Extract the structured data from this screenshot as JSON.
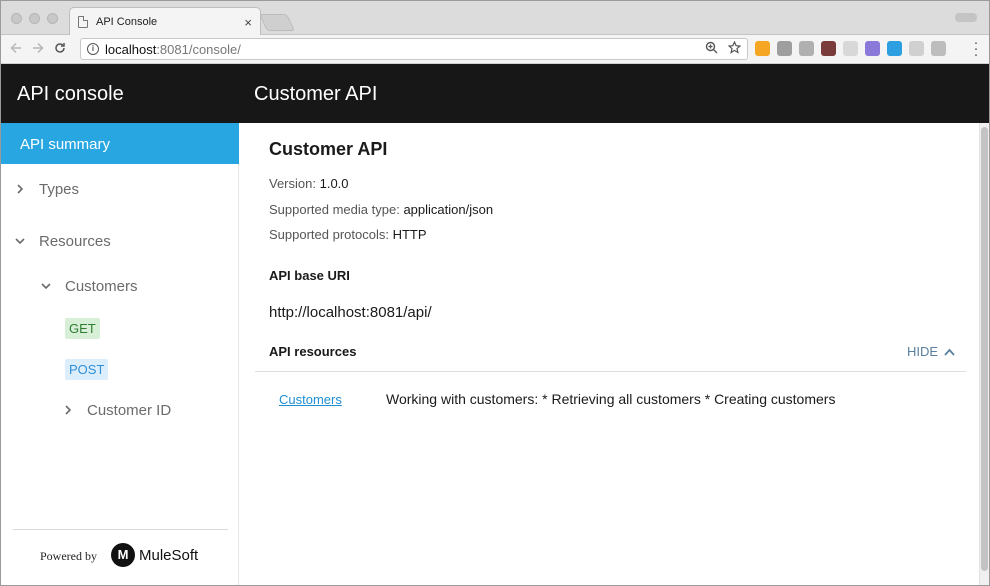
{
  "browser": {
    "tab_title": "API Console",
    "tab_close": "×",
    "url_host": "localhost",
    "url_rest": ":8081/console/",
    "icons": [
      "back-icon",
      "forward-icon",
      "reload-icon",
      "info-icon",
      "zoom-icon",
      "star-icon",
      "menu-icon"
    ],
    "extensions": [
      {
        "name": "extension-orange-icon",
        "color": "#f5a623"
      },
      {
        "name": "extension-gray-icon",
        "color": "#9e9e9e"
      },
      {
        "name": "extension-g-icon",
        "color": "#b0b0b0"
      },
      {
        "name": "extension-glasses-icon",
        "color": "#7a3b3b"
      },
      {
        "name": "extension-box-icon",
        "color": "#d8d8d8"
      },
      {
        "name": "extension-purple-icon",
        "color": "#8a79d9"
      },
      {
        "name": "extension-blue-ring-icon",
        "color": "#2d9fe0"
      },
      {
        "name": "extension-moon-icon",
        "color": "#d0d0d0"
      },
      {
        "name": "extension-m-icon",
        "color": "#bdbdbd"
      }
    ]
  },
  "header": {
    "app_title": "API console",
    "api_title": "Customer API"
  },
  "sidebar": {
    "active_item": "API summary",
    "types_label": "Types",
    "resources_label": "Resources",
    "customers_label": "Customers",
    "get_label": "GET",
    "post_label": "POST",
    "customer_id_label": "Customer ID",
    "powered_by": "Powered by",
    "brand": "MuleSoft",
    "brand_logo_letter": "M"
  },
  "main": {
    "title": "Customer API",
    "version_label": "Version:",
    "version_value": "1.0.0",
    "media_label": "Supported media type:",
    "media_value": "application/json",
    "protocols_label": "Supported protocols:",
    "protocols_value": "HTTP",
    "base_uri_label": "API base URI",
    "base_uri": "http://localhost:8081/api/",
    "resources_label": "API resources",
    "hide_label": "HIDE",
    "resources": [
      {
        "name": "Customers",
        "description": "Working with customers: * Retrieving all customers * Creating customers"
      }
    ]
  },
  "colors": {
    "header_bg": "#171717",
    "accent": "#28a6e2",
    "get_bg": "#d8efd7",
    "post_bg": "#dceefb"
  }
}
